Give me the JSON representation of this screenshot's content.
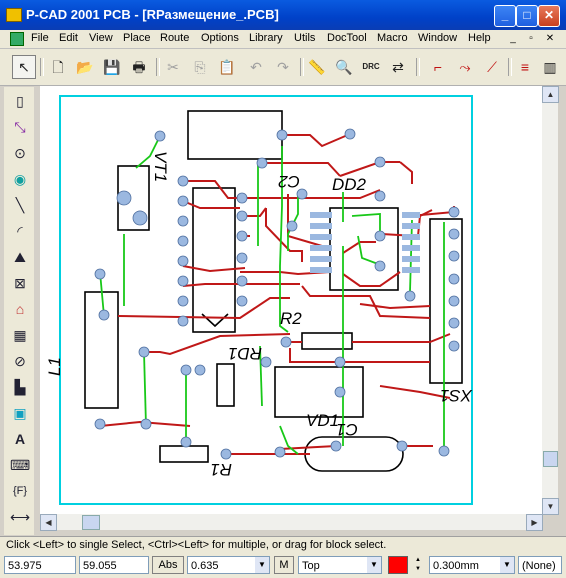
{
  "window": {
    "title": "P-CAD 2001 PCB - [RРазмещение_.PCB]",
    "minimize": "_",
    "maximize": "□",
    "close": "✕"
  },
  "menu": [
    "File",
    "Edit",
    "View",
    "Place",
    "Route",
    "Options",
    "Library",
    "Utils",
    "DocTool",
    "Macro",
    "Window",
    "Help"
  ],
  "mdi_controls": [
    "_",
    "▫",
    "✕"
  ],
  "toolbar_icons": [
    "select-arrow",
    "new-file",
    "open-folder",
    "save-disk",
    "print",
    "cut",
    "copy",
    "paste",
    "undo",
    "redo",
    "measure-ruler",
    "zoom",
    "drc-check",
    "netlist",
    "route-manual",
    "route-interactive",
    "route-miter",
    "route-bus"
  ],
  "toolbar_text": {
    "drc": "DRC"
  },
  "left_tools": [
    "place-component",
    "place-connection",
    "place-pad",
    "place-via",
    "place-line",
    "place-arc",
    "place-polygon",
    "place-copper-pour",
    "place-cutout",
    "place-keepout",
    "place-plane",
    "place-field",
    "place-text",
    "place-attribute",
    "place-dimension",
    "place-point",
    "place-attribute-ref"
  ],
  "left_tool_text": {
    "text_tool": "A",
    "field_tool": "{F}"
  },
  "pcb": {
    "labels": [
      "VT1",
      "C2",
      "DD2",
      "R2",
      "RD1",
      "L1",
      "XS1",
      "VD1",
      "C1",
      "R1"
    ]
  },
  "status": {
    "hint": "Click <Left> to single Select, <Ctrl><Left> for multiple, or drag for block select."
  },
  "bottom": {
    "x": "53.975",
    "y": "59.055",
    "abs": "Abs",
    "grid": "0.635",
    "mode": "M",
    "layer": "Top",
    "layer_color": "#ff0000",
    "width": "0.300mm",
    "style": "(None)"
  }
}
